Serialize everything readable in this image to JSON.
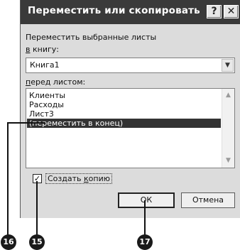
{
  "dialog": {
    "title": "Переместить или скопировать",
    "help_glyph": "?",
    "close_glyph": "✕",
    "move_label": "Переместить выбранные листы",
    "book_label_underlined": "в",
    "book_label_rest": " книгу:",
    "book_value": "Книга1",
    "before_label_underlined": "п",
    "before_label_rest": "еред листом:",
    "sheets": [
      "Клиенты",
      "Расходы",
      "Лист3",
      "(переместить в конец)"
    ],
    "selected_sheet": "(переместить в конец)",
    "create_copy_label_pre": "Создать ",
    "create_copy_label_underlined": "к",
    "create_copy_label_post": "опию",
    "create_copy_checked": true,
    "check_glyph": "✓",
    "ok_label": "ОК",
    "cancel_label": "Отмена",
    "dropdown_arrow": "▼",
    "scroll_up": "▲",
    "scroll_down": "▼"
  },
  "callouts": [
    {
      "label": "16",
      "target": "selected-sheet-item"
    },
    {
      "label": "15",
      "target": "create-copy-checkbox"
    },
    {
      "label": "17",
      "target": "ok-button"
    }
  ]
}
